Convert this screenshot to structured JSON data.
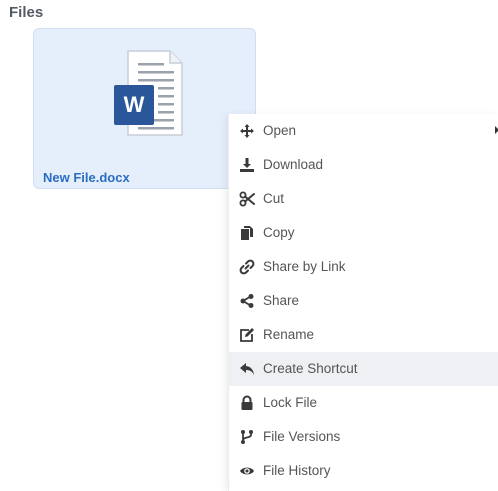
{
  "section": {
    "title": "Files"
  },
  "file": {
    "name": "New File.docx",
    "icon": "word-document-icon",
    "badge_letter": "W",
    "accent_color": "#2b579a"
  },
  "context_menu": {
    "highlighted_item": "Create Shortcut",
    "items": [
      {
        "label": "Open",
        "icon": "move-arrows-icon",
        "has_submenu": true
      },
      {
        "label": "Download",
        "icon": "download-icon"
      },
      {
        "label": "Cut",
        "icon": "scissors-icon"
      },
      {
        "label": "Copy",
        "icon": "copy-icon"
      },
      {
        "label": "Share by Link",
        "icon": "link-icon"
      },
      {
        "label": "Share",
        "icon": "share-icon"
      },
      {
        "label": "Rename",
        "icon": "edit-icon"
      },
      {
        "label": "Create Shortcut",
        "icon": "reply-arrow-icon"
      },
      {
        "label": "Lock File",
        "icon": "lock-icon"
      },
      {
        "label": "File Versions",
        "icon": "branch-icon"
      },
      {
        "label": "File History",
        "icon": "eye-icon"
      }
    ]
  }
}
